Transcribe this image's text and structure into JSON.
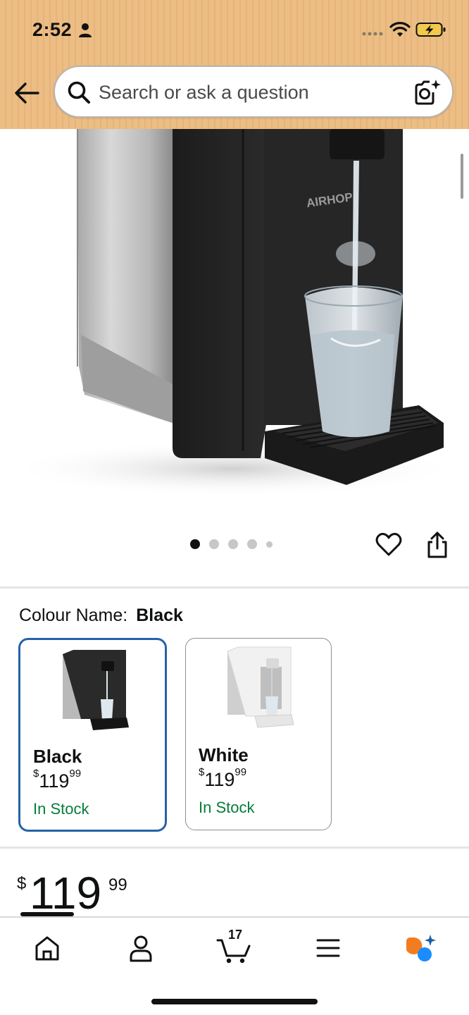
{
  "status_bar": {
    "time": "2:52"
  },
  "header": {
    "search_placeholder": "Search or ask a question",
    "background_color": "#ecbd84"
  },
  "product_image": {
    "brand_text": "AIRHOP",
    "carousel_count": 5,
    "carousel_active_index": 0
  },
  "colour_selector": {
    "label": "Colour Name:",
    "selected_value": "Black",
    "options": [
      {
        "name": "Black",
        "price_currency": "$",
        "price_whole": "119",
        "price_fraction": "99",
        "stock": "In Stock",
        "selected": true
      },
      {
        "name": "White",
        "price_currency": "$",
        "price_whole": "119",
        "price_fraction": "99",
        "stock": "In Stock",
        "selected": false
      }
    ]
  },
  "price": {
    "currency": "$",
    "whole": "119",
    "fraction": "99"
  },
  "bottom_nav": {
    "items": [
      "home-icon",
      "account-icon",
      "cart-icon",
      "menu-icon",
      "rufus-assistant-icon"
    ],
    "cart_count": "17",
    "active_index": 0
  },
  "colors": {
    "accent_selected_border": "#2662a8",
    "in_stock": "#067d3a",
    "text": "#0f1111"
  }
}
